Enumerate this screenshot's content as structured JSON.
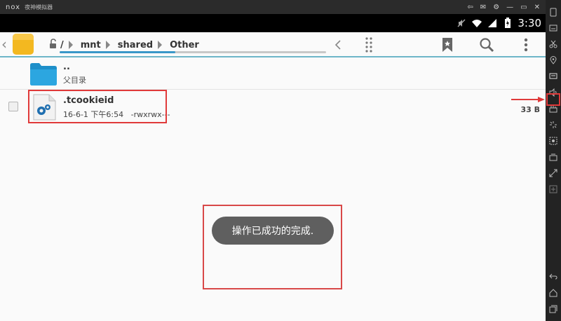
{
  "emulator": {
    "logo_text": "nox",
    "title": "夜神模拟器",
    "controls": [
      "⇦",
      "✉",
      "⚙",
      "—",
      "▭",
      "✕"
    ]
  },
  "status_bar": {
    "time": "3:30"
  },
  "toolbar": {
    "breadcrumbs": [
      "/",
      "mnt",
      "shared",
      "Other"
    ]
  },
  "file_list": {
    "parent_dots": "..",
    "parent_label": "父目录",
    "files": [
      {
        "name": ".tcookieid",
        "meta": "16-6-1 下午6:54   -rwxrwx---",
        "size": "33 B"
      }
    ]
  },
  "toast": {
    "message": "操作已成功的完成."
  },
  "colors": {
    "accent": "#3a97c8",
    "folder": "#f3b820",
    "highlight_red": "#e03a3a",
    "toast_bg": "#5f5f5f"
  },
  "icons": {
    "toolbar": [
      "folder-icon",
      "unlock-icon",
      "chevron-left-icon",
      "more-vert-icon",
      "bookmark-icon",
      "search-icon",
      "overflow-menu-icon"
    ],
    "sidebar": [
      "phone-icon",
      "keyboard-icon",
      "scissors-icon",
      "location-icon",
      "message-icon",
      "volume-icon",
      "apk-icon",
      "shake-icon",
      "screenshot-icon",
      "multi-icon",
      "resize-icon",
      "add-icon",
      "back-icon",
      "home-icon",
      "recents-icon"
    ]
  }
}
